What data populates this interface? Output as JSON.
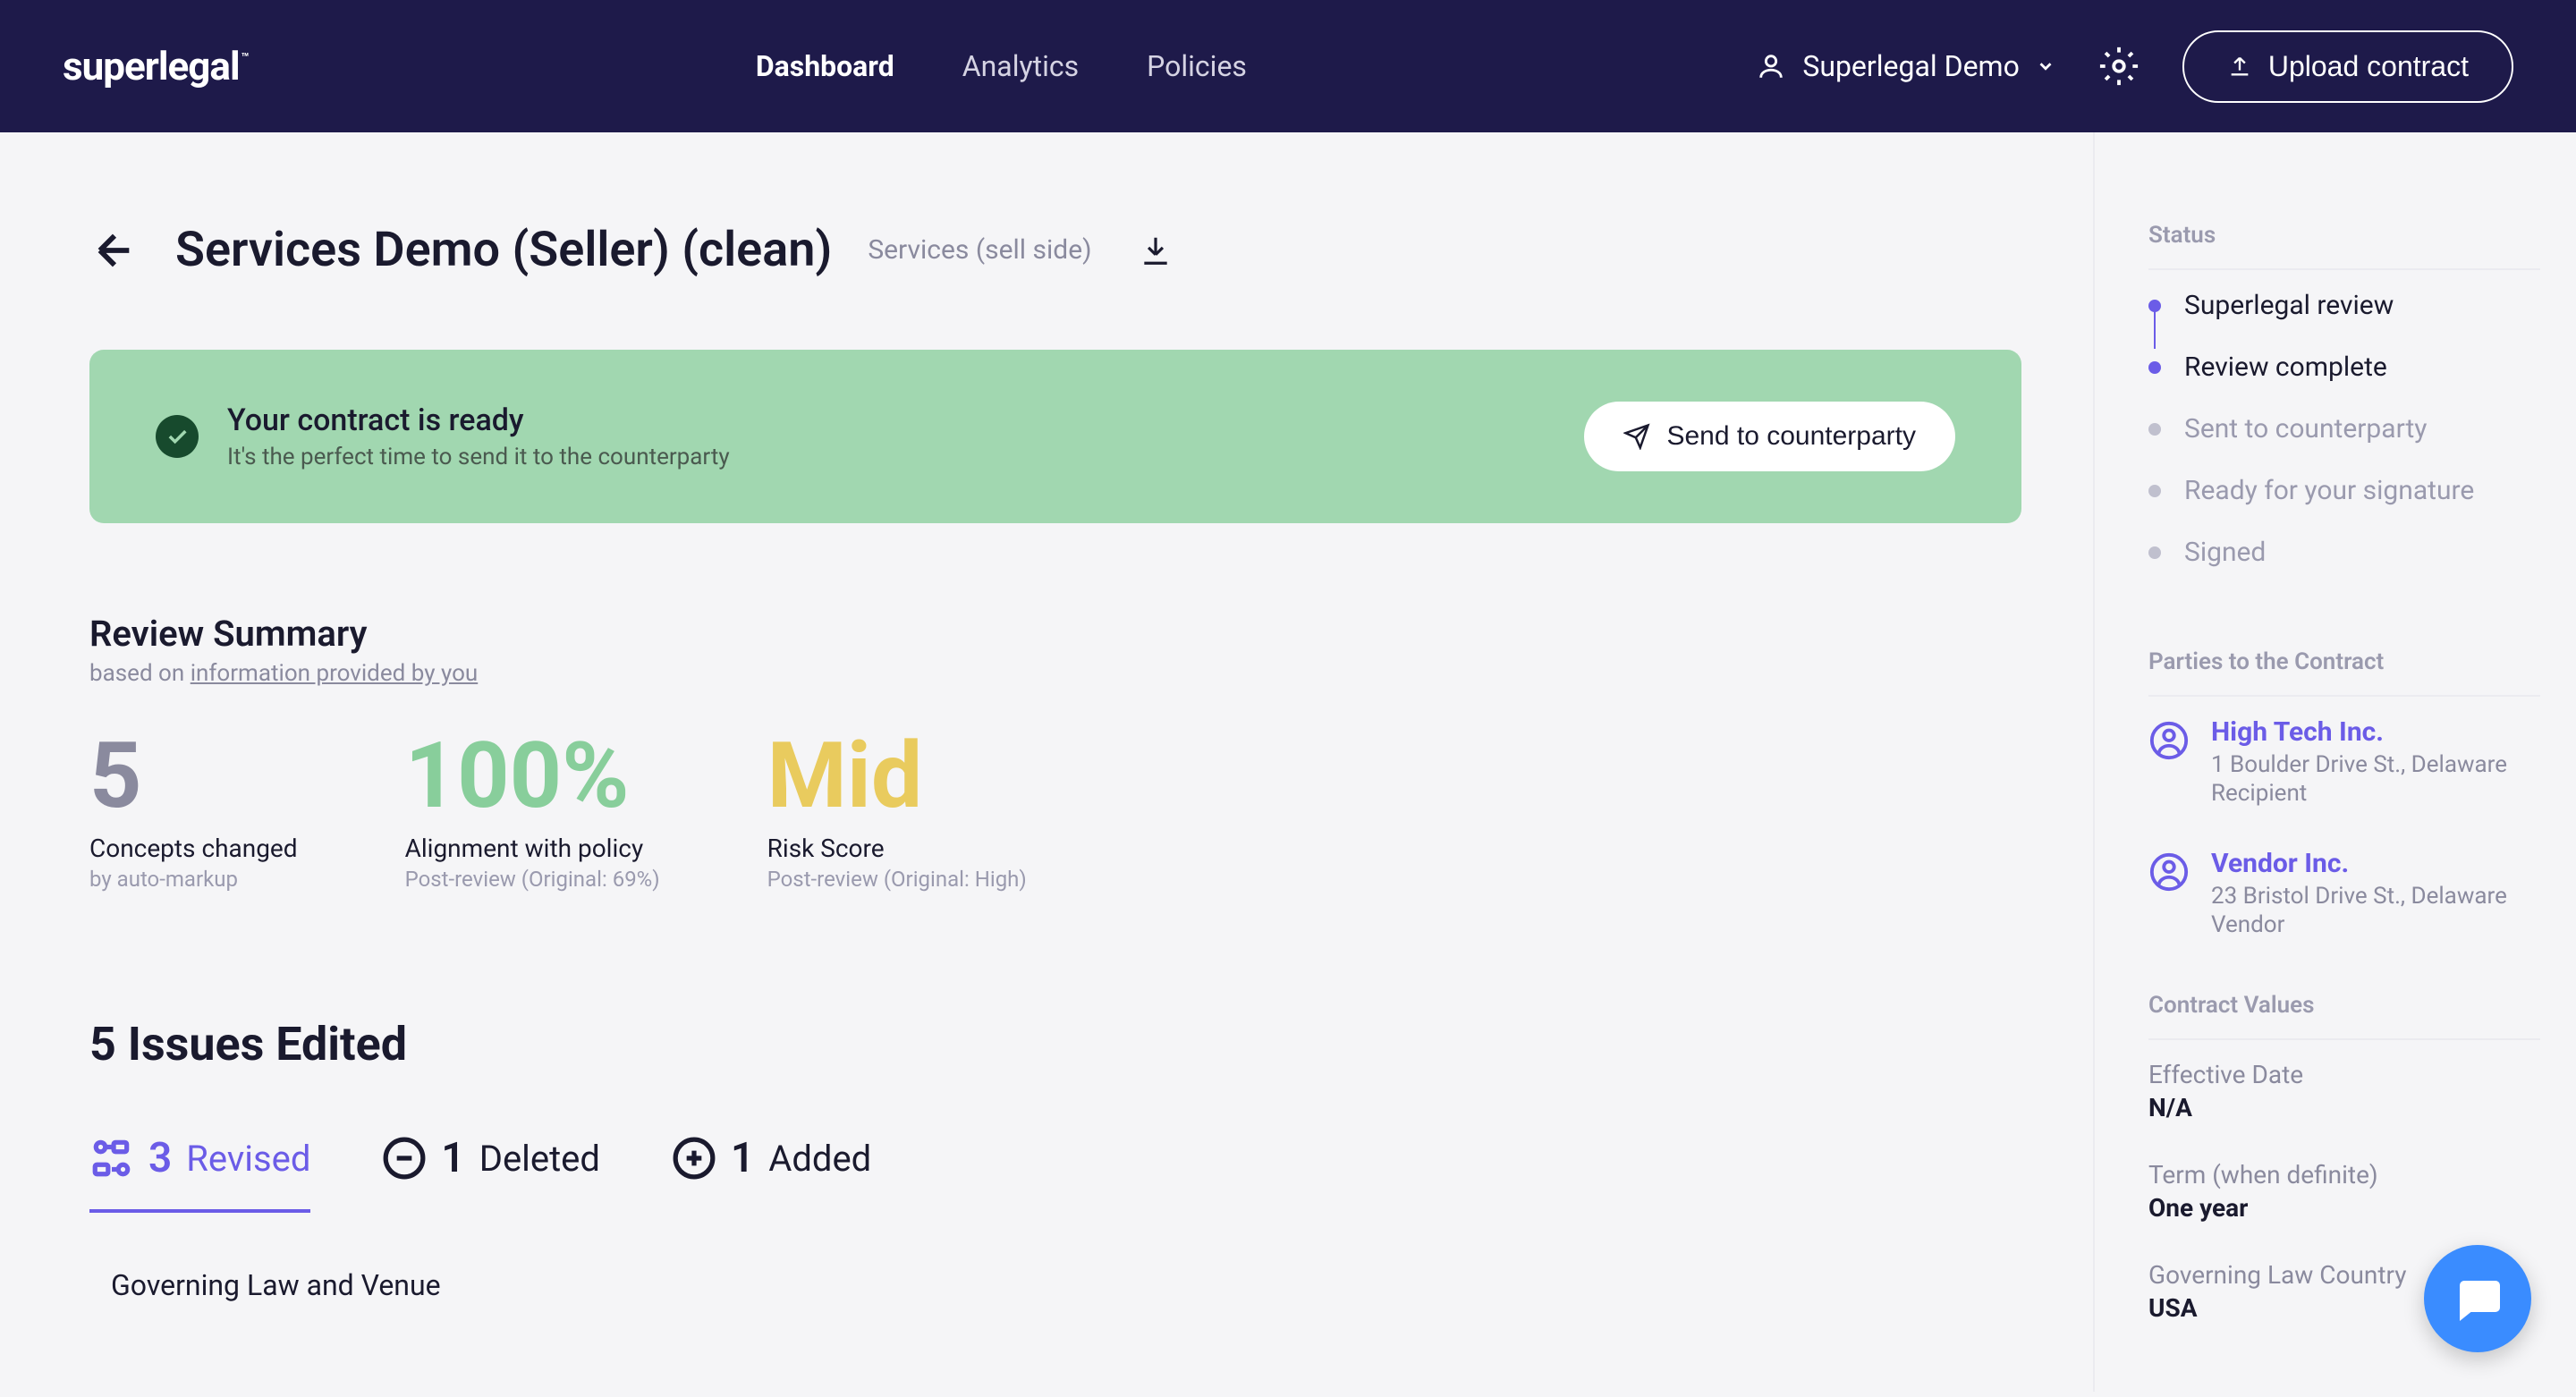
{
  "brand": "superlegal",
  "nav": {
    "dashboard": "Dashboard",
    "analytics": "Analytics",
    "policies": "Policies"
  },
  "user": {
    "name": "Superlegal Demo"
  },
  "upload_btn": "Upload contract",
  "page": {
    "title": "Services Demo (Seller) (clean)",
    "subtitle": "Services (sell side)"
  },
  "banner": {
    "title": "Your contract is ready",
    "subtitle": "It's the perfect time to send it to the counterparty",
    "button": "Send to counterparty"
  },
  "review_summary": {
    "heading": "Review Summary",
    "based_on_prefix": "based on ",
    "based_on_link": "information provided by you",
    "metrics": [
      {
        "value": "5",
        "label": "Concepts changed",
        "sub": "by auto-markup",
        "tone": "gray"
      },
      {
        "value": "100%",
        "label": "Alignment with policy",
        "sub": "Post-review (Original: 69%)",
        "tone": "green"
      },
      {
        "value": "Mid",
        "label": "Risk Score",
        "sub": "Post-review (Original: High)",
        "tone": "yellow"
      }
    ]
  },
  "issues": {
    "title": "5 Issues Edited",
    "tabs": {
      "revised": {
        "count": "3",
        "label": "Revised"
      },
      "deleted": {
        "count": "1",
        "label": "Deleted"
      },
      "added": {
        "count": "1",
        "label": "Added"
      }
    },
    "first_item": "Governing Law and Venue"
  },
  "status": {
    "heading": "Status",
    "steps": [
      {
        "label": "Superlegal review",
        "done": true
      },
      {
        "label": "Review complete",
        "done": true
      },
      {
        "label": "Sent to counterparty",
        "done": false
      },
      {
        "label": "Ready for your signature",
        "done": false
      },
      {
        "label": "Signed",
        "done": false
      }
    ]
  },
  "parties": {
    "heading": "Parties to the Contract",
    "items": [
      {
        "name": "High Tech Inc.",
        "addr": "1 Boulder Drive St., Delaware",
        "role": "Recipient"
      },
      {
        "name": "Vendor Inc.",
        "addr": "23 Bristol Drive St., Delaware",
        "role": "Vendor"
      }
    ]
  },
  "contract_values": {
    "heading": "Contract Values",
    "items": [
      {
        "label": "Effective Date",
        "value": "N/A"
      },
      {
        "label": "Term (when definite)",
        "value": "One year"
      },
      {
        "label": "Governing Law Country",
        "value": "USA"
      }
    ]
  }
}
